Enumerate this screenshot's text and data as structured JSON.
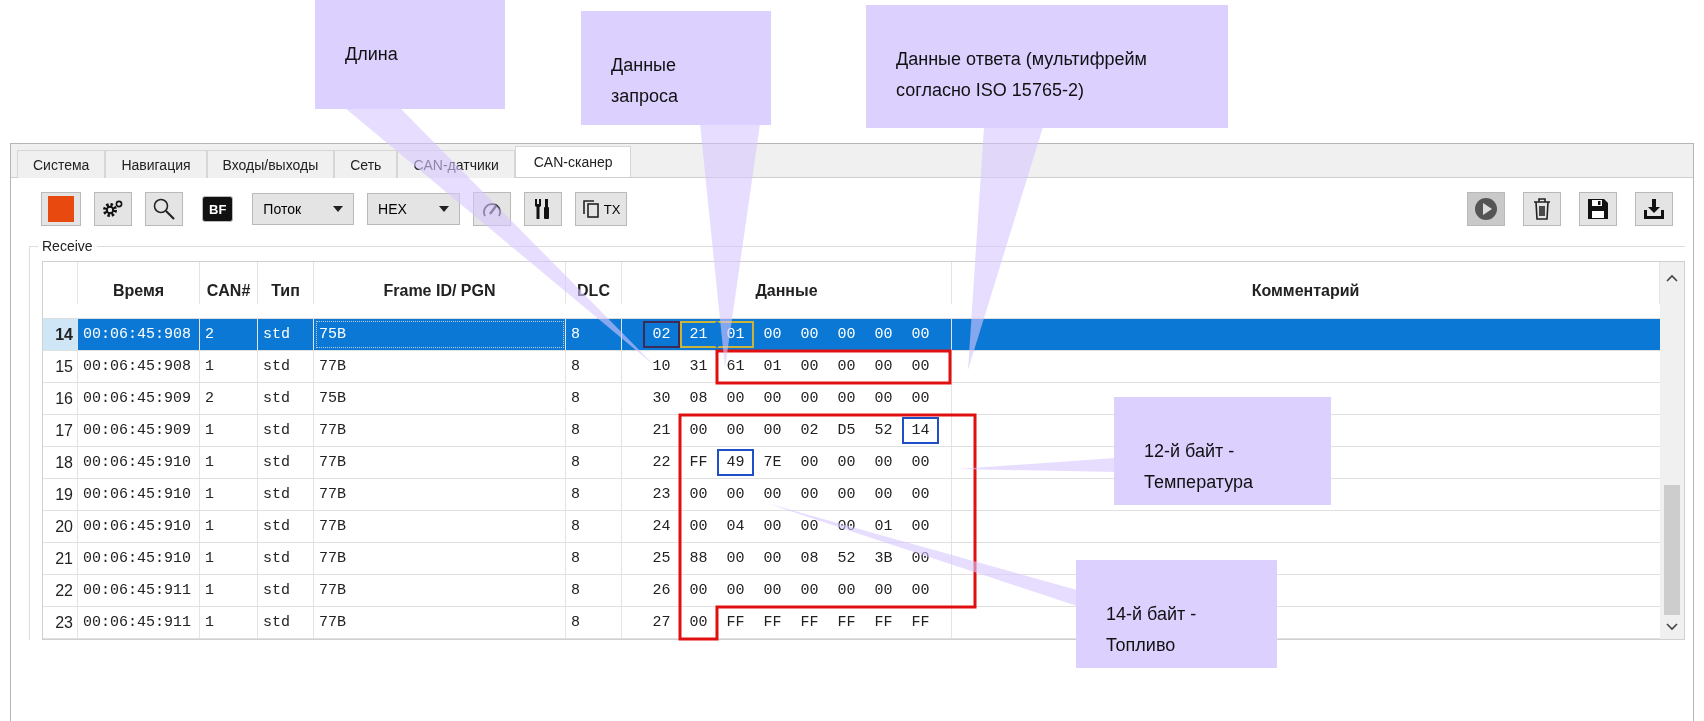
{
  "callouts": [
    {
      "kind": "length",
      "lines": [
        "Длина"
      ]
    },
    {
      "kind": "request",
      "lines": [
        "Данные",
        "запроса"
      ]
    },
    {
      "kind": "response",
      "lines": [
        "Данные ответа (мультифрейм",
        "согласно ISO 15765-2)"
      ]
    },
    {
      "kind": "temperature",
      "lines": [
        "12-й байт -",
        "Температура"
      ]
    },
    {
      "kind": "fuel",
      "lines": [
        "14-й байт -",
        "Топливо"
      ]
    }
  ],
  "tabs": [
    {
      "label": "Система",
      "selected": false
    },
    {
      "label": "Навигация",
      "selected": false
    },
    {
      "label": "Входы/выходы",
      "selected": false
    },
    {
      "label": "Сеть",
      "selected": false
    },
    {
      "label": "CAN-датчики",
      "selected": false
    },
    {
      "label": "CAN-сканер",
      "selected": true
    }
  ],
  "toolbar_left": [
    {
      "kind": "stop"
    },
    {
      "kind": "settings"
    },
    {
      "kind": "search"
    },
    {
      "kind": "bf",
      "label": "BF"
    },
    {
      "kind": "combo",
      "value": "Поток"
    },
    {
      "kind": "combo",
      "value": "HEX"
    },
    {
      "kind": "gauge"
    },
    {
      "kind": "tools"
    },
    {
      "kind": "copy",
      "label": "TX"
    }
  ],
  "toolbar_right": [
    {
      "kind": "play",
      "pressed": true
    },
    {
      "kind": "trash",
      "pressed": false
    },
    {
      "kind": "save",
      "pressed": false
    },
    {
      "kind": "download",
      "pressed": false
    }
  ],
  "group_label": "Receive",
  "columns": [
    "",
    "Время",
    "CAN#",
    "Тип",
    "Frame ID/ PGN",
    "DLC",
    "Данные",
    "Комментарий"
  ],
  "rows": [
    {
      "n": "14",
      "time": "00:06:45:908",
      "can": "2",
      "type": "std",
      "id": "75B",
      "dlc": "8",
      "selected": true,
      "bytes": [
        {
          "v": "02",
          "color": "#3d2a57"
        },
        {
          "v": "21",
          "color": "#c9b33a"
        },
        {
          "v": "01",
          "color": "#c9b33a"
        },
        {
          "v": "00"
        },
        {
          "v": "00"
        },
        {
          "v": "00"
        },
        {
          "v": "00"
        },
        {
          "v": "00"
        }
      ]
    },
    {
      "n": "15",
      "time": "00:06:45:908",
      "can": "1",
      "type": "std",
      "id": "77B",
      "dlc": "8",
      "selected": false,
      "bytes": [
        {
          "v": "10"
        },
        {
          "v": "31"
        },
        {
          "v": "61"
        },
        {
          "v": "01"
        },
        {
          "v": "00"
        },
        {
          "v": "00"
        },
        {
          "v": "00"
        },
        {
          "v": "00"
        }
      ]
    },
    {
      "n": "16",
      "time": "00:06:45:909",
      "can": "2",
      "type": "std",
      "id": "75B",
      "dlc": "8",
      "selected": false,
      "bytes": [
        {
          "v": "30"
        },
        {
          "v": "08"
        },
        {
          "v": "00"
        },
        {
          "v": "00"
        },
        {
          "v": "00"
        },
        {
          "v": "00"
        },
        {
          "v": "00"
        },
        {
          "v": "00"
        }
      ]
    },
    {
      "n": "17",
      "time": "00:06:45:909",
      "can": "1",
      "type": "std",
      "id": "77B",
      "dlc": "8",
      "selected": false,
      "bytes": [
        {
          "v": "21"
        },
        {
          "v": "00"
        },
        {
          "v": "00"
        },
        {
          "v": "00"
        },
        {
          "v": "02"
        },
        {
          "v": "D5"
        },
        {
          "v": "52"
        },
        {
          "v": "14",
          "color": "#1f4fc8"
        }
      ]
    },
    {
      "n": "18",
      "time": "00:06:45:910",
      "can": "1",
      "type": "std",
      "id": "77B",
      "dlc": "8",
      "selected": false,
      "bytes": [
        {
          "v": "22"
        },
        {
          "v": "FF"
        },
        {
          "v": "49",
          "color": "#1f4fc8"
        },
        {
          "v": "7E"
        },
        {
          "v": "00"
        },
        {
          "v": "00"
        },
        {
          "v": "00"
        },
        {
          "v": "00"
        }
      ]
    },
    {
      "n": "19",
      "time": "00:06:45:910",
      "can": "1",
      "type": "std",
      "id": "77B",
      "dlc": "8",
      "selected": false,
      "bytes": [
        {
          "v": "23"
        },
        {
          "v": "00"
        },
        {
          "v": "00"
        },
        {
          "v": "00"
        },
        {
          "v": "00"
        },
        {
          "v": "00"
        },
        {
          "v": "00"
        },
        {
          "v": "00"
        }
      ]
    },
    {
      "n": "20",
      "time": "00:06:45:910",
      "can": "1",
      "type": "std",
      "id": "77B",
      "dlc": "8",
      "selected": false,
      "bytes": [
        {
          "v": "24"
        },
        {
          "v": "00"
        },
        {
          "v": "04"
        },
        {
          "v": "00"
        },
        {
          "v": "00"
        },
        {
          "v": "00"
        },
        {
          "v": "01"
        },
        {
          "v": "00"
        }
      ]
    },
    {
      "n": "21",
      "time": "00:06:45:910",
      "can": "1",
      "type": "std",
      "id": "77B",
      "dlc": "8",
      "selected": false,
      "bytes": [
        {
          "v": "25"
        },
        {
          "v": "88"
        },
        {
          "v": "00"
        },
        {
          "v": "00"
        },
        {
          "v": "08"
        },
        {
          "v": "52"
        },
        {
          "v": "3B"
        },
        {
          "v": "00"
        }
      ]
    },
    {
      "n": "22",
      "time": "00:06:45:911",
      "can": "1",
      "type": "std",
      "id": "77B",
      "dlc": "8",
      "selected": false,
      "bytes": [
        {
          "v": "26"
        },
        {
          "v": "00"
        },
        {
          "v": "00"
        },
        {
          "v": "00"
        },
        {
          "v": "00"
        },
        {
          "v": "00"
        },
        {
          "v": "00"
        },
        {
          "v": "00"
        }
      ]
    },
    {
      "n": "23",
      "time": "00:06:45:911",
      "can": "1",
      "type": "std",
      "id": "77B",
      "dlc": "8",
      "selected": false,
      "bytes": [
        {
          "v": "27"
        },
        {
          "v": "00"
        },
        {
          "v": "FF"
        },
        {
          "v": "FF"
        },
        {
          "v": "FF"
        },
        {
          "v": "FF"
        },
        {
          "v": "FF"
        },
        {
          "v": "FF"
        }
      ]
    }
  ]
}
